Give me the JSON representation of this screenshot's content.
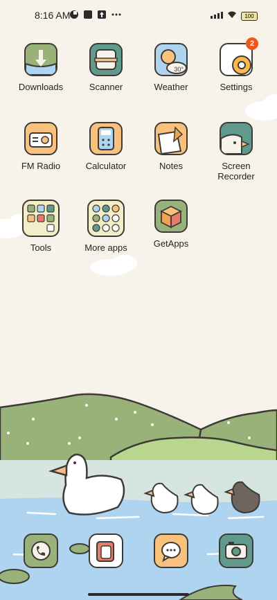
{
  "status": {
    "time": "8:16 AM",
    "battery": "100"
  },
  "apps": {
    "row1": [
      "Downloads",
      "Scanner",
      "Weather",
      "Settings"
    ],
    "row2": [
      "FM Radio",
      "Calculator",
      "Notes",
      "Screen Recorder"
    ],
    "row3": [
      "Tools",
      "More apps",
      "GetApps"
    ]
  },
  "weather_temp": "30°",
  "settings_badge": "2",
  "dock": [
    "phone",
    "contacts",
    "messages",
    "camera"
  ],
  "colors": {
    "background": "#f8f3ea",
    "accent_green": "#98b27a",
    "accent_orange": "#f9c17e",
    "water": "#aed4ef",
    "badge": "#f2561d"
  }
}
